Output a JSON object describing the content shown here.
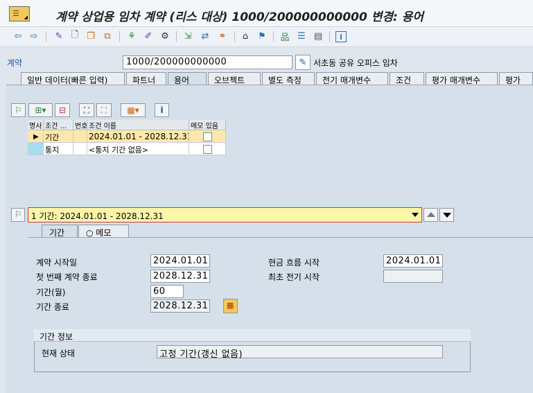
{
  "window": {
    "title": "계약 상업용 임차 계약 (리스 대상) 1000/200000000000 변경: 용어"
  },
  "header": {
    "contract_label": "계약",
    "contract_value": "1000/200000000000",
    "contract_description": "서초동 공유 오피스 임차"
  },
  "tabs": [
    {
      "label": "일반 데이터(빠른 입력)"
    },
    {
      "label": "파트너"
    },
    {
      "label": "용어"
    },
    {
      "label": "오브젝트"
    },
    {
      "label": "별도 측정"
    },
    {
      "label": "전기 매개변수"
    },
    {
      "label": "조건"
    },
    {
      "label": "평가 매개변수"
    },
    {
      "label": "평가"
    }
  ],
  "table": {
    "columns": [
      "명사",
      "조건 ...",
      "번호",
      "조건 이름",
      "메모 있음"
    ],
    "rows": [
      {
        "type": "기간",
        "name": "2024.01.01 - 2028.12.31",
        "memo": false
      },
      {
        "type": "통지",
        "name": "<통지 기간 없음>",
        "memo": false
      }
    ]
  },
  "selector": {
    "value": "1 기간: 2024.01.01 - 2028.12.31"
  },
  "subtabs": [
    {
      "label": "기간"
    },
    {
      "label": "○ 메모"
    }
  ],
  "form": {
    "start_label": "계약 시작일",
    "start_value": "2024.01.01",
    "first_end_label": "첫 번째 계약 종료",
    "first_end_value": "2028.12.31",
    "months_label": "기간(월)",
    "months_value": "60",
    "period_end_label": "기간 종료",
    "period_end_value": "2028.12.31",
    "cashflow_label": "현금 흐름 시작",
    "cashflow_value": "2024.01.01",
    "first_posting_label": "최초 전기 시작",
    "first_posting_value": ""
  },
  "period_info": {
    "title": "기간 정보",
    "status_label": "현재 상태",
    "status_value": "고정 기간(갱신 없음)"
  }
}
